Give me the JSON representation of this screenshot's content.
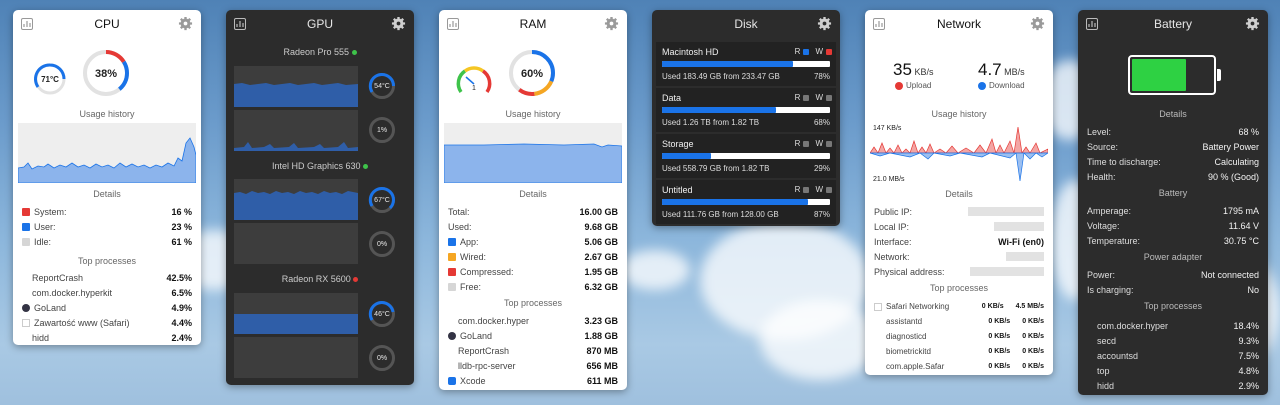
{
  "cpu": {
    "title": "CPU",
    "temp": "71°C",
    "usage": "38%",
    "history_label": "Usage history",
    "details_label": "Details",
    "details": [
      {
        "label": "System:",
        "value": "16 %",
        "color": "#e53935"
      },
      {
        "label": "User:",
        "value": "23 %",
        "color": "#1a73e8"
      },
      {
        "label": "Idle:",
        "value": "61 %",
        "color": "#d6d6d6"
      }
    ],
    "processes_label": "Top processes",
    "processes": [
      {
        "name": "ReportCrash",
        "value": "42.5%"
      },
      {
        "name": "com.docker.hyperkit",
        "value": "6.5%"
      },
      {
        "name": "GoLand",
        "value": "4.9%"
      },
      {
        "name": "Zawartość www (Safari)",
        "value": "4.4%"
      },
      {
        "name": "hidd",
        "value": "2.4%"
      }
    ]
  },
  "gpu": {
    "title": "GPU",
    "gpus": [
      {
        "name": "Radeon Pro 555",
        "status_color": "#3ec34a",
        "temp": "54°C",
        "usage": "1%"
      },
      {
        "name": "Intel HD Graphics 630",
        "status_color": "#3ec34a",
        "temp": "67°C",
        "usage": "0%"
      },
      {
        "name": "Radeon RX 5600",
        "status_color": "#e53935",
        "temp": "46°C",
        "usage": "0%"
      }
    ]
  },
  "ram": {
    "title": "RAM",
    "pressure_value": "1",
    "usage": "60%",
    "history_label": "Usage history",
    "details_label": "Details",
    "details": [
      {
        "label": "Total:",
        "value": "16.00 GB",
        "color": ""
      },
      {
        "label": "Used:",
        "value": "9.68 GB",
        "color": ""
      },
      {
        "label": "App:",
        "value": "5.06 GB",
        "color": "#1a73e8"
      },
      {
        "label": "Wired:",
        "value": "2.67 GB",
        "color": "#f5a623"
      },
      {
        "label": "Compressed:",
        "value": "1.95 GB",
        "color": "#e53935"
      },
      {
        "label": "Free:",
        "value": "6.32 GB",
        "color": "#d6d6d6"
      }
    ],
    "processes_label": "Top processes",
    "processes": [
      {
        "name": "com.docker.hyper",
        "value": "3.23 GB"
      },
      {
        "name": "GoLand",
        "value": "1.88 GB"
      },
      {
        "name": "ReportCrash",
        "value": "870 MB"
      },
      {
        "name": "lldb-rpc-server",
        "value": "656 MB"
      },
      {
        "name": "Xcode",
        "value": "611 MB"
      }
    ]
  },
  "disk": {
    "title": "Disk",
    "read_label": "R",
    "write_label": "W",
    "disks": [
      {
        "name": "Macintosh HD",
        "used": "Used 183.49 GB from 233.47 GB",
        "percent": "78%",
        "fill": 0.78,
        "read_active": true,
        "write_active": true
      },
      {
        "name": "Data",
        "used": "Used 1.26 TB from 1.82 TB",
        "percent": "68%",
        "fill": 0.68,
        "read_active": false,
        "write_active": false
      },
      {
        "name": "Storage",
        "used": "Used 558.79 GB from 1.82 TB",
        "percent": "29%",
        "fill": 0.29,
        "read_active": false,
        "write_active": false
      },
      {
        "name": "Untitled",
        "used": "Used 111.76 GB from 128.00 GB",
        "percent": "87%",
        "fill": 0.87,
        "read_active": false,
        "write_active": false
      }
    ]
  },
  "network": {
    "title": "Network",
    "upload_value": "35",
    "upload_unit": "KB/s",
    "upload_label": "Upload",
    "download_value": "4.7",
    "download_unit": "MB/s",
    "download_label": "Download",
    "history_label": "Usage history",
    "scale_top": "147 KB/s",
    "scale_bottom": "21.0 MB/s",
    "details_label": "Details",
    "details": [
      {
        "label": "Public IP:",
        "value": ""
      },
      {
        "label": "Local IP:",
        "value": ""
      },
      {
        "label": "Interface:",
        "value": "Wi-Fi (en0)"
      },
      {
        "label": "Network:",
        "value": ""
      },
      {
        "label": "Physical address:",
        "value": ""
      }
    ],
    "processes_label": "Top processes",
    "processes": [
      {
        "name": "Safari Networking",
        "up": "0 KB/s",
        "down": "4.5 MB/s"
      },
      {
        "name": "assistantd",
        "up": "0 KB/s",
        "down": "0 KB/s"
      },
      {
        "name": "diagnosticd",
        "up": "0 KB/s",
        "down": "0 KB/s"
      },
      {
        "name": "biometrickitd",
        "up": "0 KB/s",
        "down": "0 KB/s"
      },
      {
        "name": "com.apple.Safar",
        "up": "0 KB/s",
        "down": "0 KB/s"
      }
    ]
  },
  "battery": {
    "title": "Battery",
    "level_fraction": 0.68,
    "details_label": "Details",
    "details": [
      {
        "label": "Level:",
        "value": "68 %"
      },
      {
        "label": "Source:",
        "value": "Battery Power"
      },
      {
        "label": "Time to discharge:",
        "value": "Calculating"
      },
      {
        "label": "Health:",
        "value": "90 % (Good)"
      }
    ],
    "battery_label": "Battery",
    "battery_rows": [
      {
        "label": "Amperage:",
        "value": "1795 mA"
      },
      {
        "label": "Voltage:",
        "value": "11.64 V"
      },
      {
        "label": "Temperature:",
        "value": "30.75 °C"
      }
    ],
    "adapter_label": "Power adapter",
    "adapter_rows": [
      {
        "label": "Power:",
        "value": "Not connected"
      },
      {
        "label": "Is charging:",
        "value": "No"
      }
    ],
    "processes_label": "Top processes",
    "processes": [
      {
        "name": "com.docker.hyper",
        "value": "18.4%"
      },
      {
        "name": "secd",
        "value": "9.3%"
      },
      {
        "name": "accountsd",
        "value": "7.5%"
      },
      {
        "name": "top",
        "value": "4.8%"
      },
      {
        "name": "hidd",
        "value": "2.9%"
      }
    ]
  }
}
